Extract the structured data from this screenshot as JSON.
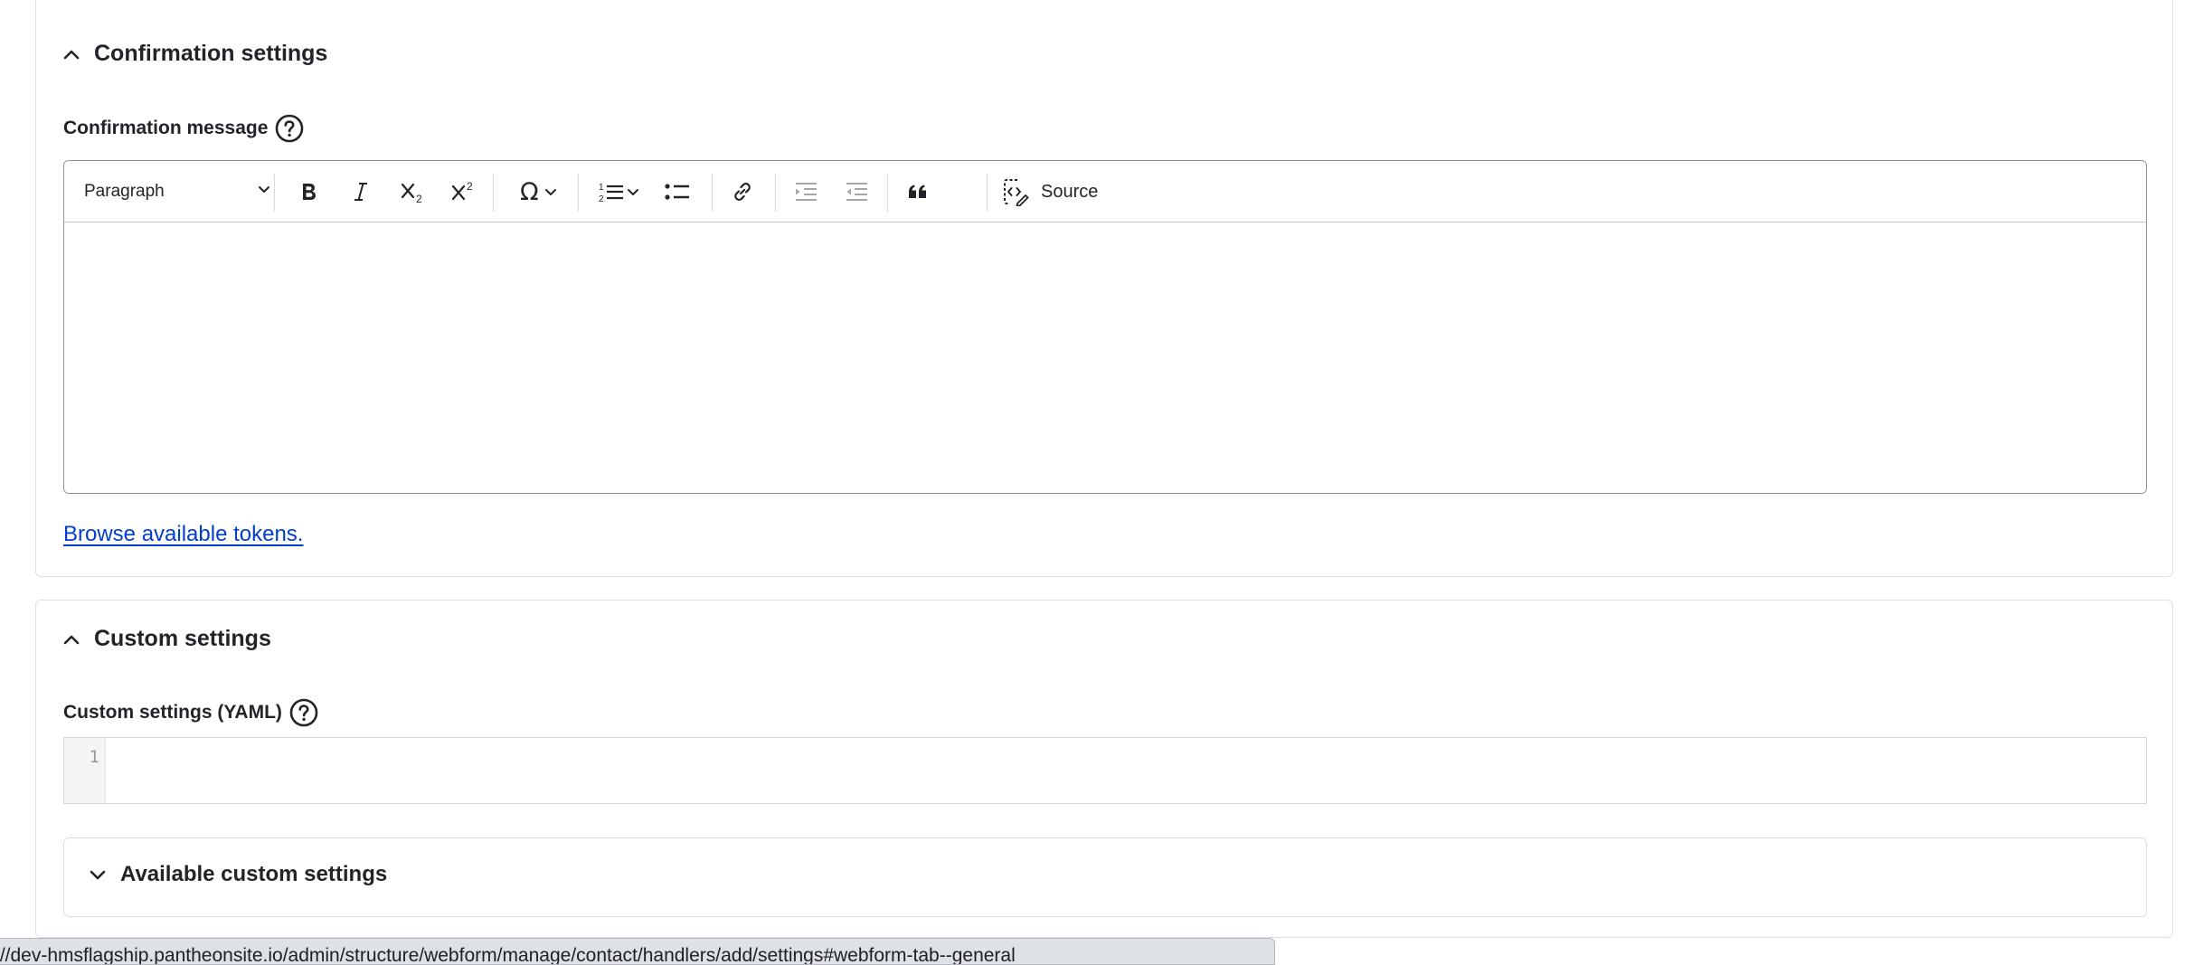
{
  "confirmation": {
    "title": "Confirmation settings",
    "message_label": "Confirmation message",
    "toolbar": {
      "heading": "Paragraph",
      "source_label": "Source"
    },
    "tokens_link": "Browse available tokens."
  },
  "custom": {
    "title": "Custom settings",
    "yaml_label": "Custom settings (YAML)",
    "line_number": "1",
    "available_title": "Available custom settings"
  },
  "status_url": "://dev-hmsflagship.pantheonsite.io/admin/structure/webform/manage/contact/handlers/add/settings#webform-tab--general"
}
